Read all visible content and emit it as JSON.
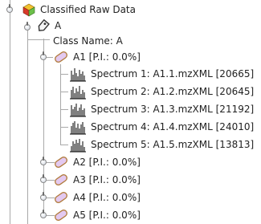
{
  "tree": {
    "root": {
      "label": "Classified Raw Data",
      "icon": "colored-cubes-icon"
    },
    "class_node": {
      "label": "A",
      "icon": "tag-icon"
    },
    "class_name": "Class Name: A",
    "children": [
      {
        "label": "A1 [P.I.: 0.0%]",
        "icon": "pill-icon",
        "expanded": true,
        "spectra": [
          {
            "label": "Spectrum 1: A1.1.mzXML [20665]",
            "icon": "spectrum-icon"
          },
          {
            "label": "Spectrum 2: A1.2.mzXML [20645]",
            "icon": "spectrum-icon"
          },
          {
            "label": "Spectrum 3: A1.3.mzXML [21192]",
            "icon": "spectrum-icon"
          },
          {
            "label": "Spectrum 4: A1.4.mzXML [24010]",
            "icon": "spectrum-icon"
          },
          {
            "label": "Spectrum 5: A1.5.mzXML [13813]",
            "icon": "spectrum-icon"
          }
        ]
      },
      {
        "label": "A2 [P.I.: 0.0%]",
        "icon": "pill-icon",
        "expanded": false
      },
      {
        "label": "A3 [P.I.: 0.0%]",
        "icon": "pill-icon",
        "expanded": false
      },
      {
        "label": "A4 [P.I.: 0.0%]",
        "icon": "pill-icon",
        "expanded": false
      },
      {
        "label": "A5 [P.I.: 0.0%]",
        "icon": "pill-icon",
        "expanded": false
      }
    ]
  },
  "colors": {
    "line": "#a9a9a9",
    "pill_fill": "#e3c9f0",
    "pill_stroke": "#b07a3a",
    "cube_red": "#d83a2a",
    "cube_green": "#6cc04a",
    "cube_yellow": "#f2c230"
  }
}
